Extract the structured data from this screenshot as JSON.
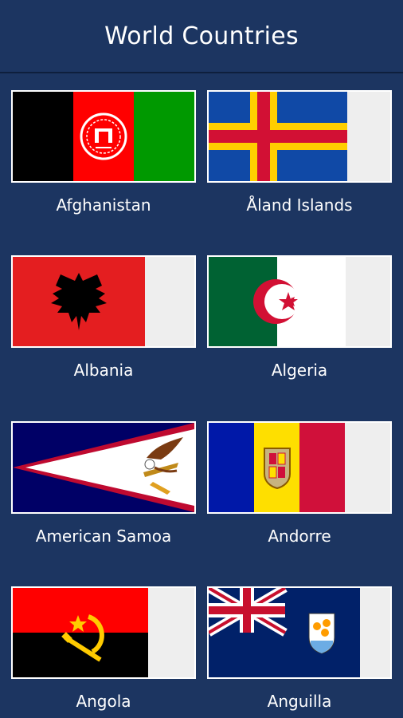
{
  "app": {
    "title": "World Countries"
  },
  "countries": [
    {
      "name": "Afghanistan",
      "flag_icon": "afghanistan-flag-icon",
      "colors": [
        "#000000",
        "#ff0000",
        "#009900"
      ]
    },
    {
      "name": "Åland Islands",
      "flag_icon": "aland-islands-flag-icon",
      "colors": [
        "#1049a6",
        "#ffce00",
        "#d21034"
      ]
    },
    {
      "name": "Albania",
      "flag_icon": "albania-flag-icon",
      "colors": [
        "#e41e20",
        "#000000"
      ]
    },
    {
      "name": "Algeria",
      "flag_icon": "algeria-flag-icon",
      "colors": [
        "#006233",
        "#ffffff",
        "#d21034"
      ]
    },
    {
      "name": "American Samoa",
      "flag_icon": "american-samoa-flag-icon",
      "colors": [
        "#000066",
        "#ffffff",
        "#bf0a30"
      ]
    },
    {
      "name": "Andorre",
      "flag_icon": "andorra-flag-icon",
      "colors": [
        "#0018a8",
        "#fedf00",
        "#d0103a"
      ]
    },
    {
      "name": "Angola",
      "flag_icon": "angola-flag-icon",
      "colors": [
        "#ff0000",
        "#000000",
        "#ffcb00"
      ]
    },
    {
      "name": "Anguilla",
      "flag_icon": "anguilla-flag-icon",
      "colors": [
        "#012169",
        "#c8102e",
        "#ffffff",
        "#ff9c00"
      ]
    }
  ]
}
